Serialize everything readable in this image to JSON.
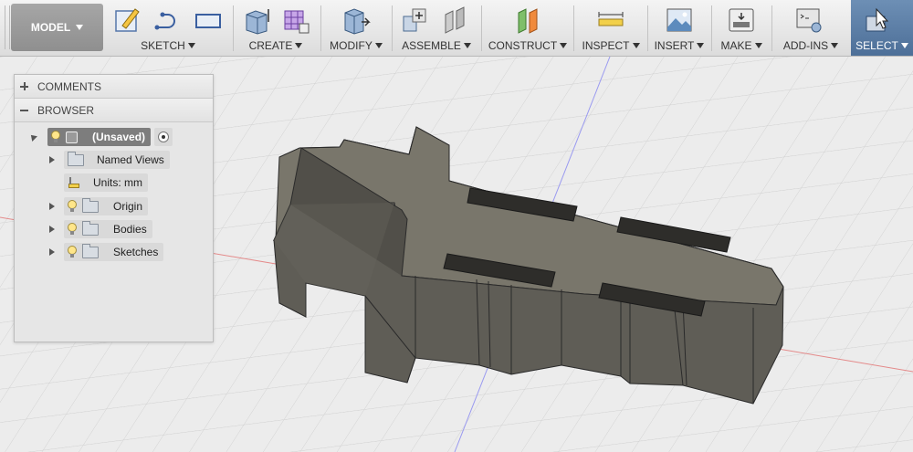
{
  "toolbar": {
    "workspace_label": "MODEL",
    "groups": {
      "sketch": "SKETCH",
      "create": "CREATE",
      "modify": "MODIFY",
      "assemble": "ASSEMBLE",
      "construct": "CONSTRUCT",
      "inspect": "INSPECT",
      "insert": "INSERT",
      "make": "MAKE",
      "addins": "ADD-INS",
      "select": "SELECT"
    }
  },
  "panel": {
    "comments_label": "COMMENTS",
    "browser_label": "BROWSER",
    "root_label": "(Unsaved)",
    "items": {
      "named_views": "Named Views",
      "units": "Units: mm",
      "origin": "Origin",
      "bodies": "Bodies",
      "sketches": "Sketches"
    }
  },
  "colors": {
    "model_face": "#6f6c62",
    "model_side": "#585650",
    "grid": "#d2d2d2",
    "axis_red": "#e07a7a",
    "axis_blue": "#8f8fe6",
    "select_active": "#5a7ca5"
  }
}
